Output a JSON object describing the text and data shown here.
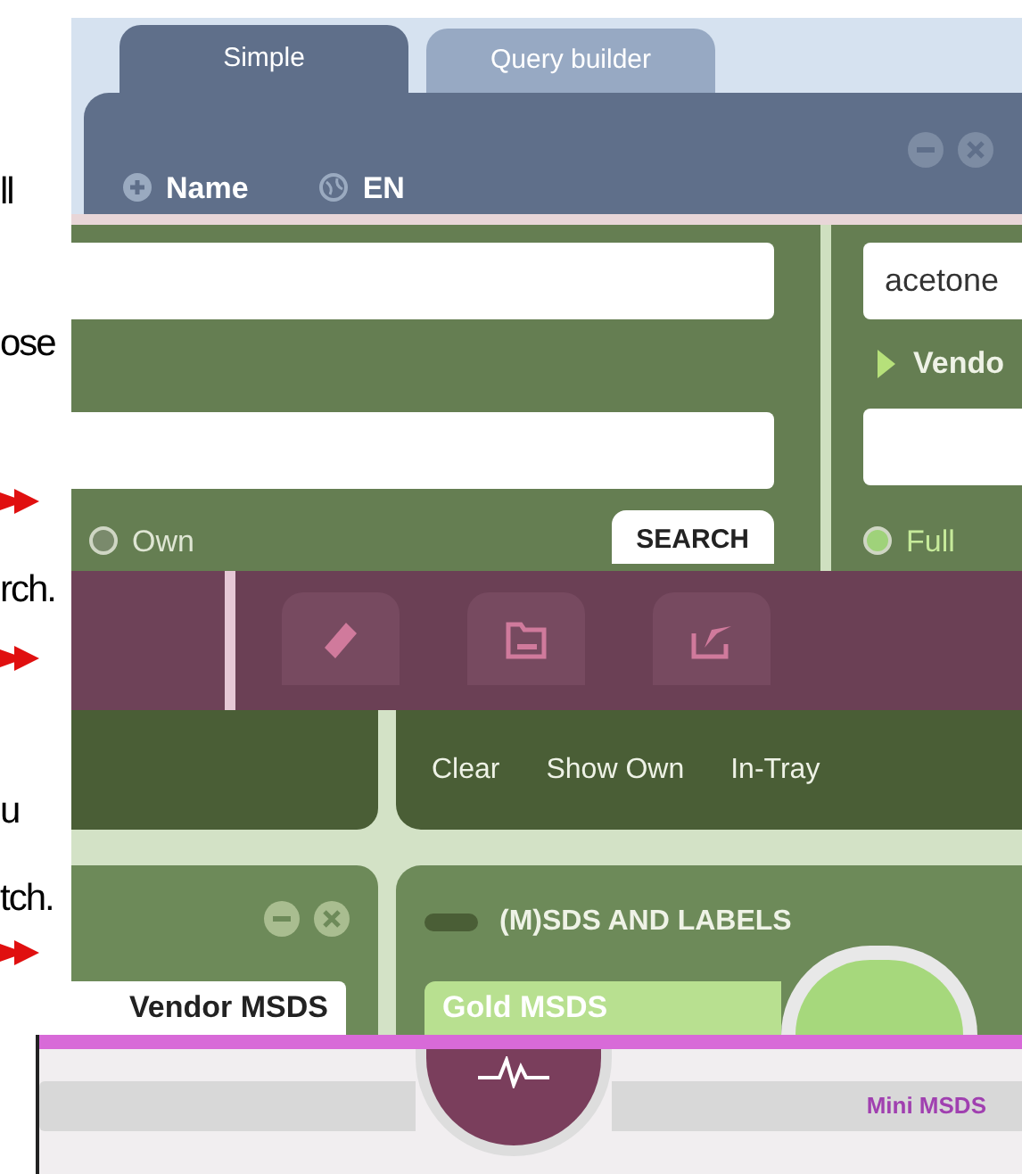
{
  "gutter_text": [
    "ll",
    "ose",
    "rch.",
    "u",
    "tch."
  ],
  "tabs": [
    {
      "label": "Simple",
      "selected": true
    },
    {
      "label": "Query builder",
      "selected": false
    }
  ],
  "header": {
    "name_label": "Name",
    "language": "EN"
  },
  "scope": [
    {
      "label": "Own",
      "selected": false
    },
    {
      "label": "Full",
      "selected": true
    }
  ],
  "search_button": "SEARCH",
  "right_field": {
    "value": "acetone"
  },
  "vendor_toggle": {
    "label": "Vendo",
    "expanded": false
  },
  "toolbar": [
    {
      "label": "Clear",
      "kind": "eraser"
    },
    {
      "label": "Show Own",
      "kind": "folder"
    },
    {
      "label": "In-Tray",
      "kind": "tray"
    }
  ],
  "vendor_panel": {
    "tab": "Vendor MSDS"
  },
  "sds_panel": {
    "title": "(M)SDS AND LABELS",
    "item": "Gold MSDS"
  },
  "footer": {
    "right_label": "Mini MSDS"
  }
}
